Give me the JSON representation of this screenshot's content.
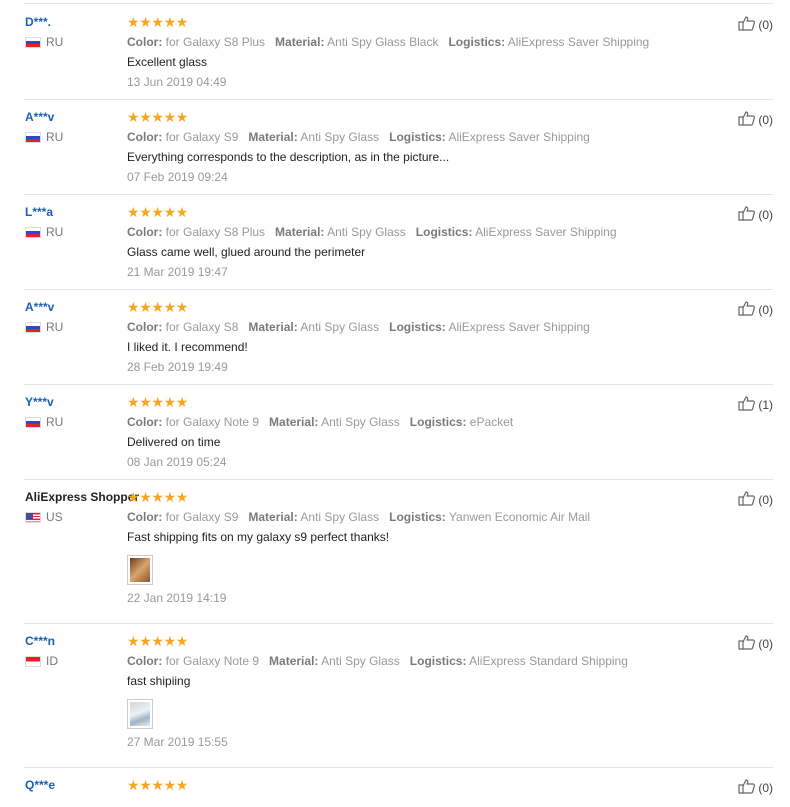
{
  "reviews": [
    {
      "user": "D***.",
      "country": "RU",
      "flag": "ru",
      "stars": 5,
      "attrs": [
        [
          "Color:",
          "for Galaxy S8 Plus"
        ],
        [
          "Material:",
          "Anti Spy Glass Black"
        ],
        [
          "Logistics:",
          "AliExpress Saver Shipping"
        ]
      ],
      "text": "Excellent glass",
      "date": "13 Jun 2019 04:49",
      "helpful": "(0)"
    },
    {
      "user": "A***v",
      "country": "RU",
      "flag": "ru",
      "stars": 5,
      "attrs": [
        [
          "Color:",
          "for Galaxy S9"
        ],
        [
          "Material:",
          "Anti Spy Glass"
        ],
        [
          "Logistics:",
          "AliExpress Saver Shipping"
        ]
      ],
      "text": "Everything corresponds to the description, as in the picture...",
      "date": "07 Feb 2019 09:24",
      "helpful": "(0)"
    },
    {
      "user": "L***a",
      "country": "RU",
      "flag": "ru",
      "stars": 5,
      "attrs": [
        [
          "Color:",
          "for Galaxy S8 Plus"
        ],
        [
          "Material:",
          "Anti Spy Glass"
        ],
        [
          "Logistics:",
          "AliExpress Saver Shipping"
        ]
      ],
      "text": "Glass came well, glued around the perimeter",
      "date": "21 Mar 2019 19:47",
      "helpful": "(0)"
    },
    {
      "user": "A***v",
      "country": "RU",
      "flag": "ru",
      "stars": 5,
      "attrs": [
        [
          "Color:",
          "for Galaxy S8"
        ],
        [
          "Material:",
          "Anti Spy Glass"
        ],
        [
          "Logistics:",
          "AliExpress Saver Shipping"
        ]
      ],
      "text": "I liked it. I recommend!",
      "date": "28 Feb 2019 19:49",
      "helpful": "(0)"
    },
    {
      "user": "Y***v",
      "country": "RU",
      "flag": "ru",
      "stars": 5,
      "attrs": [
        [
          "Color:",
          "for Galaxy Note 9"
        ],
        [
          "Material:",
          "Anti Spy Glass"
        ],
        [
          "Logistics:",
          "ePacket"
        ]
      ],
      "text": "Delivered on time",
      "date": "08 Jan 2019 05:24",
      "helpful": "(1)"
    },
    {
      "user": "AliExpress Shopper",
      "country": "US",
      "flag": "us",
      "stars": 5,
      "plain": true,
      "attrs": [
        [
          "Color:",
          "for Galaxy S9"
        ],
        [
          "Material:",
          "Anti Spy Glass"
        ],
        [
          "Logistics:",
          "Yanwen Economic Air Mail"
        ]
      ],
      "text": "Fast shipping fits on my galaxy s9 perfect thanks!",
      "photo": "a",
      "date": "22 Jan 2019 14:19",
      "helpful": "(0)"
    },
    {
      "user": "C***n",
      "country": "ID",
      "flag": "id",
      "stars": 5,
      "attrs": [
        [
          "Color:",
          "for Galaxy Note 9"
        ],
        [
          "Material:",
          "Anti Spy Glass"
        ],
        [
          "Logistics:",
          "AliExpress Standard Shipping"
        ]
      ],
      "text": "fast shipiing",
      "photo": "b",
      "date": "27 Mar 2019 15:55",
      "helpful": "(0)"
    },
    {
      "user": "Q***e",
      "country": "",
      "flag": "",
      "stars": 5,
      "attrs": [],
      "text": "",
      "date": "",
      "helpful": "(0)"
    }
  ],
  "colors": {
    "star": "#f6a623",
    "username": "#1a5fb4",
    "divider": "#e5e5e5"
  },
  "icons": {
    "star": "star-icon",
    "helpful": "thumbs-up-icon"
  }
}
